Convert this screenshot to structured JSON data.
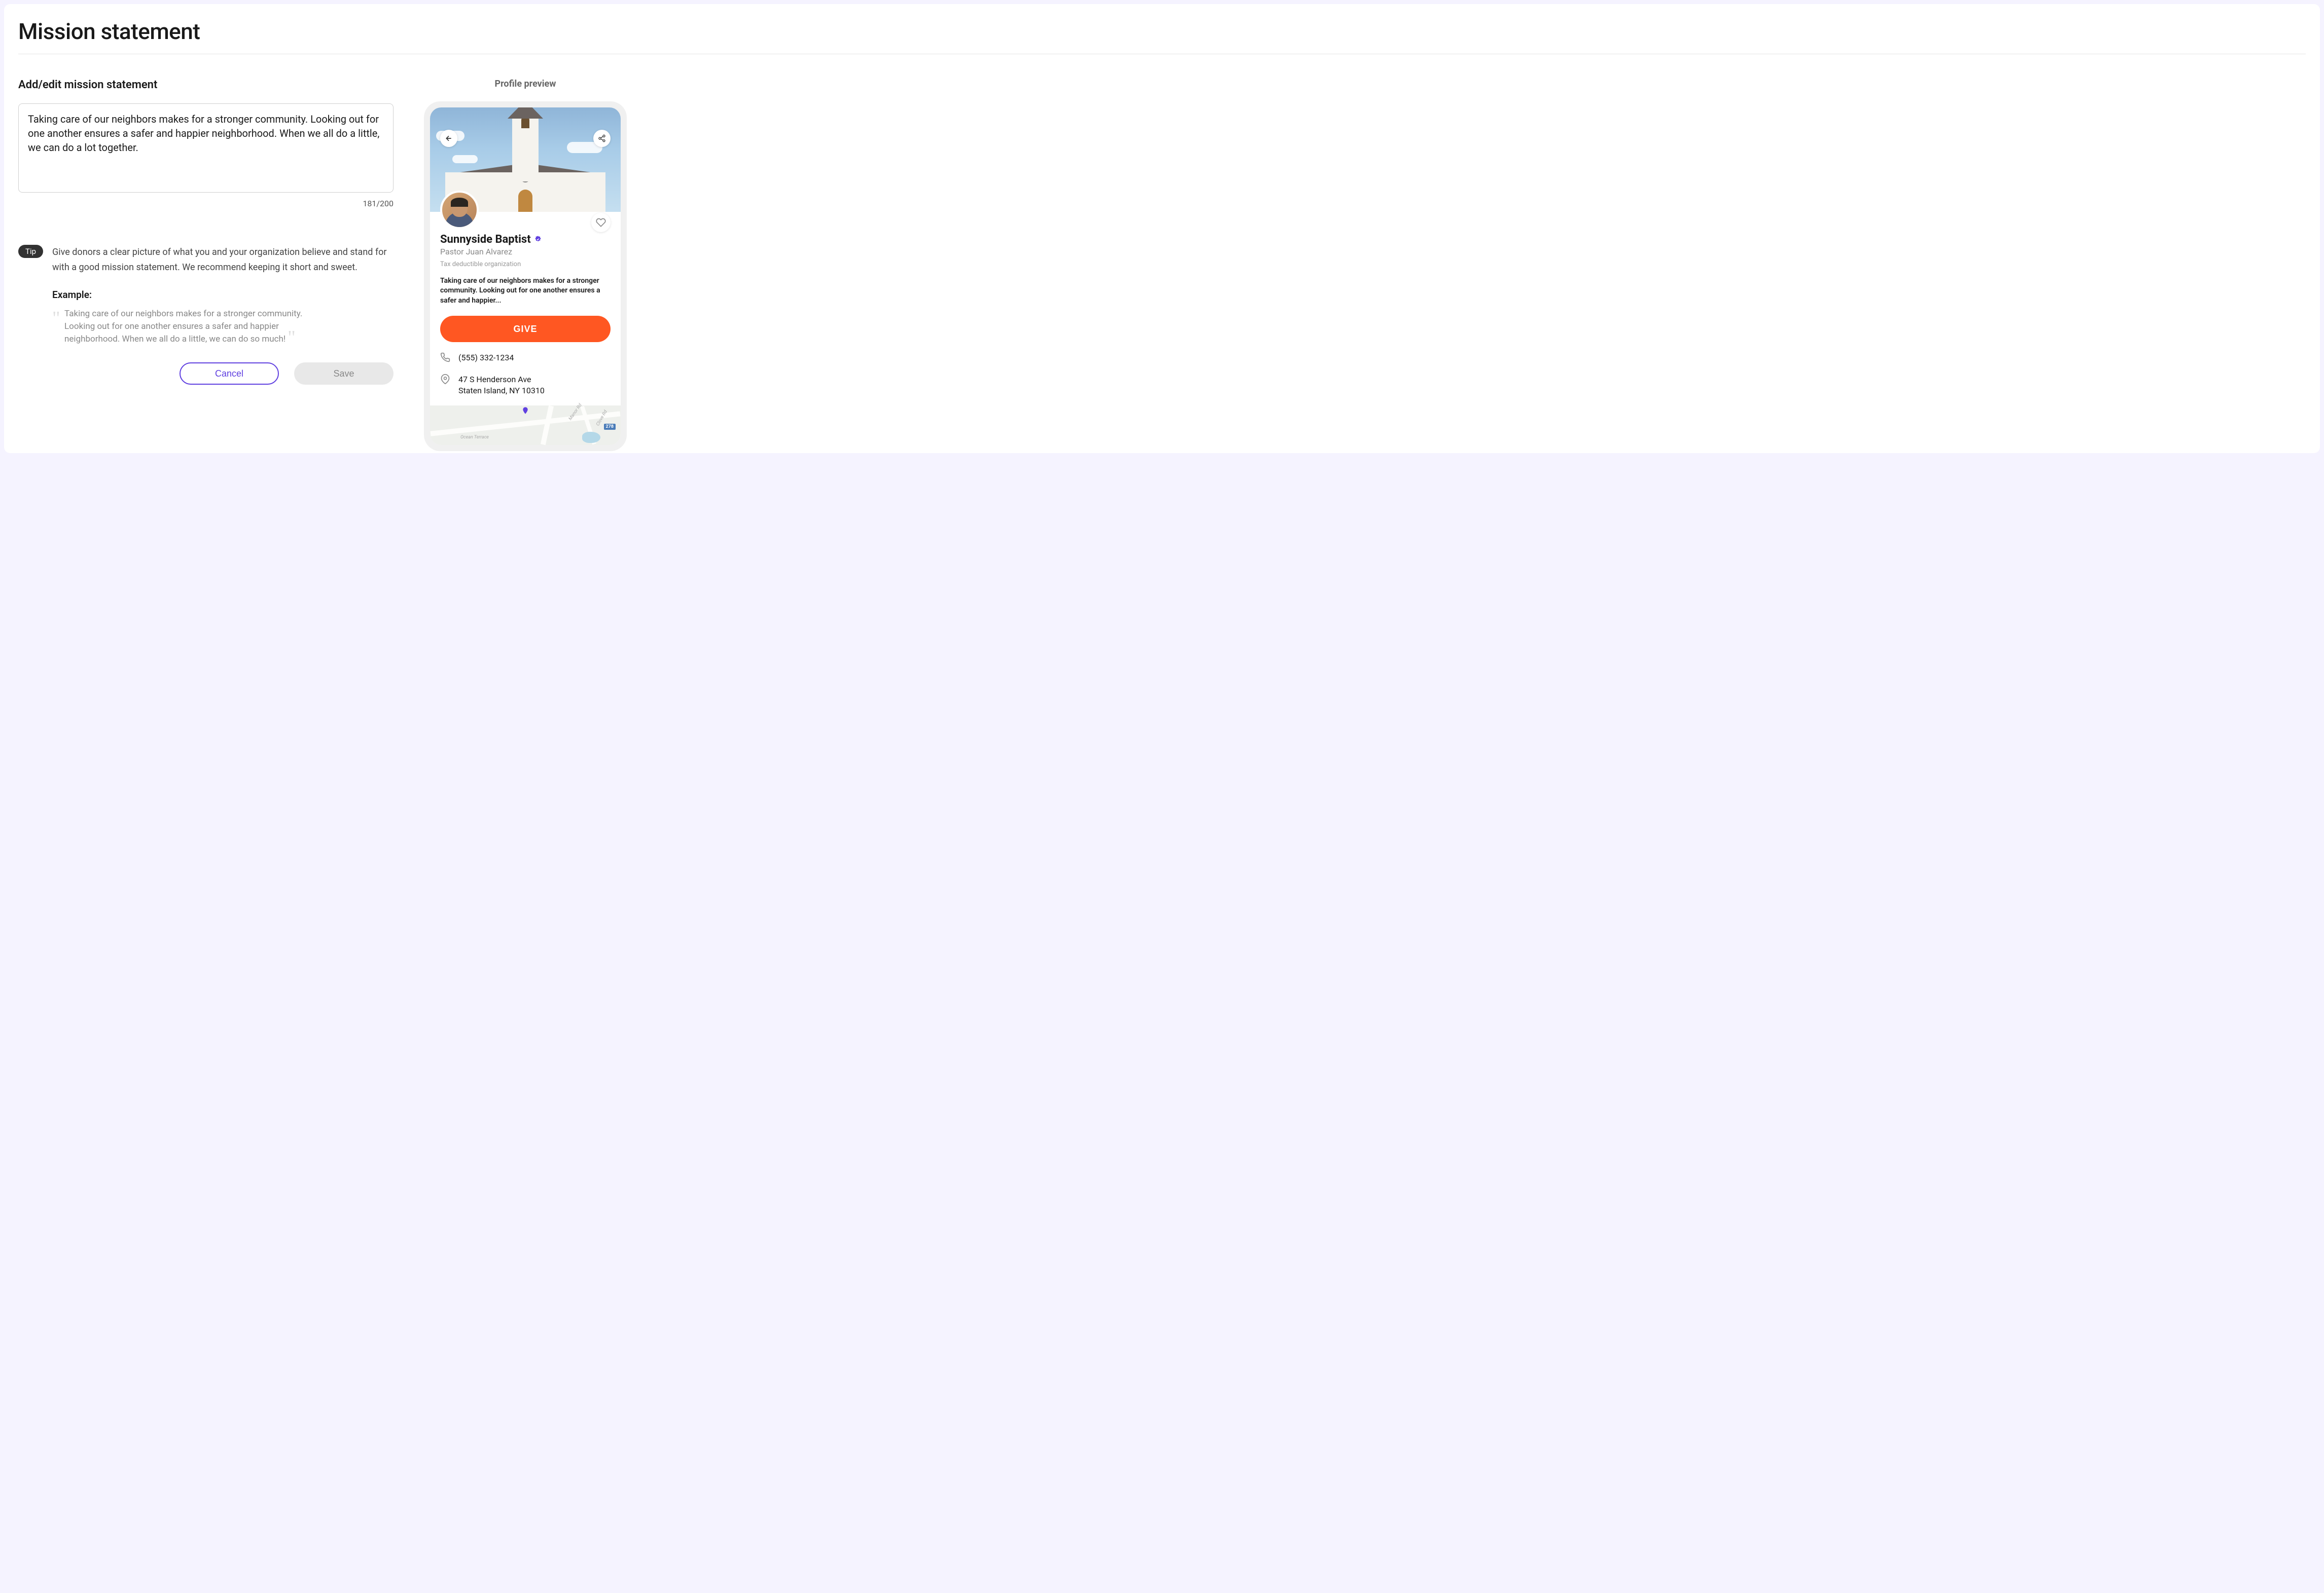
{
  "page": {
    "title": "Mission statement"
  },
  "editor": {
    "heading": "Add/edit mission statement",
    "textarea_value": "Taking care of our neighbors makes for a stronger community. Looking out for one another ensures a safer and happier neighborhood. When we all do a little, we can do a lot together.",
    "char_count": "181/200"
  },
  "tip": {
    "badge": "Tip",
    "text": "Give donors a clear picture of what you and your organization believe and stand for with a good mission statement. We recommend keeping it short and sweet.",
    "example_heading": "Example:",
    "example_text": "Taking care of our neighbors makes for a stronger community. Looking out for one another ensures a safer and happier neighborhood. When we all do a little, we can do so much!"
  },
  "buttons": {
    "cancel": "Cancel",
    "save": "Save"
  },
  "preview": {
    "heading": "Profile preview",
    "org_name": "Sunnyside Baptist",
    "org_subtitle": "Pastor Juan Alvarez",
    "tax_note": "Tax deductible organization",
    "mission_truncated": "Taking care of our neighbors makes for a stronger community. Looking out for one another ensures a safer and happier...",
    "give_label": "GIVE",
    "phone": "(555) 332-1234",
    "address_line1": "47 S Henderson Ave",
    "address_line2": "Staten Island, NY 10310",
    "map": {
      "label_ocean": "Ocean Terrace",
      "label_manor": "Manor Rd",
      "label_clove": "Clove Rd",
      "route": "278"
    }
  }
}
